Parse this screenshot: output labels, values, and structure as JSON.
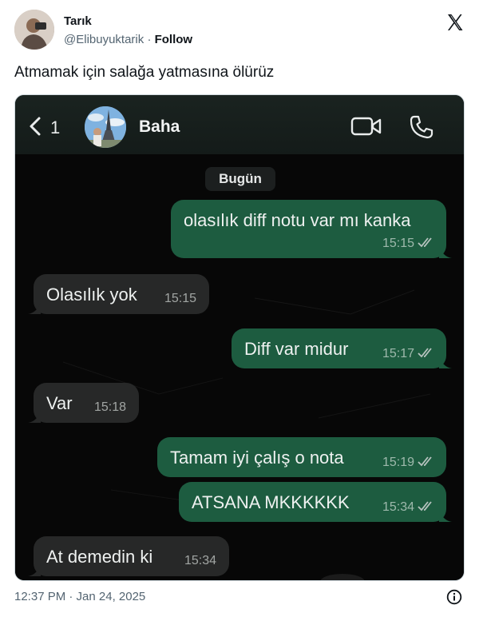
{
  "tweet": {
    "author_name": "Tarık",
    "handle": "@Elibuyuktarik",
    "separator": "·",
    "follow_label": "Follow",
    "text": "Atmamak için salağa yatmasına ölürüz",
    "timestamp": "12:37 PM · Jan 24, 2025"
  },
  "chat": {
    "back_count": "1",
    "contact_name": "Baha",
    "date_label": "Bugün",
    "messages": [
      {
        "direction": "out",
        "text": "olasılık diff notu var mı kanka",
        "time": "15:15"
      },
      {
        "direction": "in",
        "text": "Olasılık yok",
        "time": "15:15"
      },
      {
        "direction": "out",
        "text": "Diff var midur",
        "time": "15:17"
      },
      {
        "direction": "in",
        "text": "Var",
        "time": "15:18"
      },
      {
        "direction": "out",
        "text": "Tamam iyi çalış o nota",
        "time": "15:19"
      },
      {
        "direction": "out",
        "text": "ATSANA MKKKKKK",
        "time": "15:34"
      },
      {
        "direction": "in",
        "text": "At demedin ki",
        "time": "15:34"
      }
    ]
  },
  "colors": {
    "outgoing_bubble": "#1d5c40",
    "incoming_bubble": "#272828",
    "chat_background": "#070707"
  },
  "icons": [
    "x-logo-icon",
    "back-chevron-icon",
    "video-call-icon",
    "phone-call-icon",
    "double-check-icon",
    "info-icon"
  ]
}
